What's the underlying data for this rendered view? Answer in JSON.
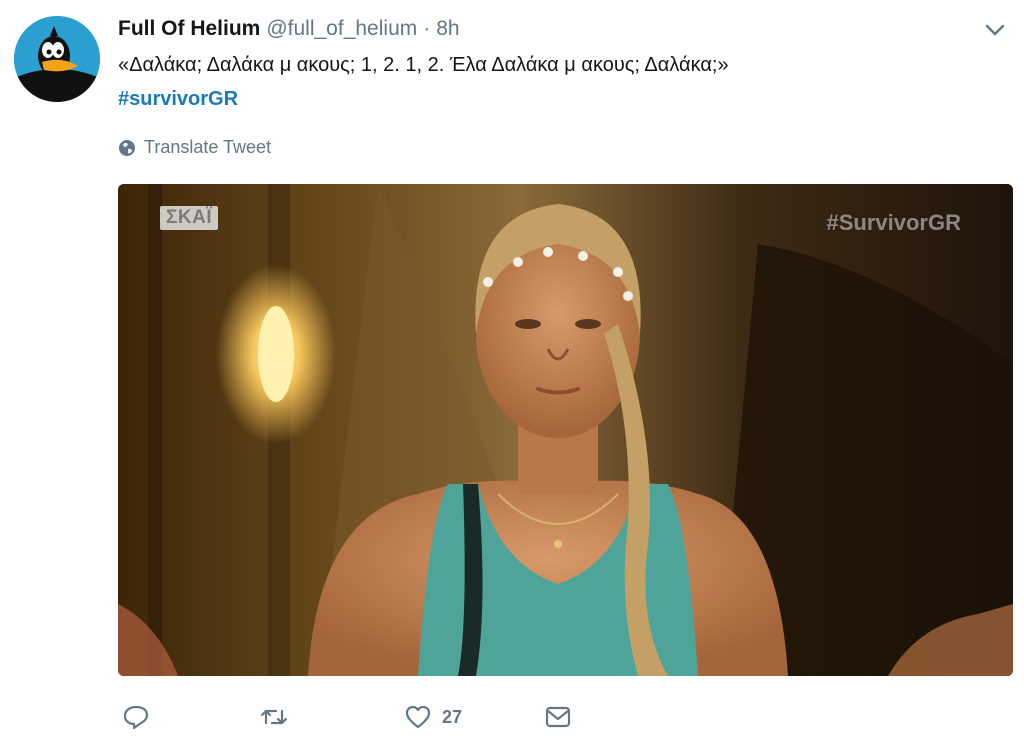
{
  "tweet": {
    "display_name": "Full Of Helium",
    "handle": "@full_of_helium",
    "separator": "·",
    "time": "8h",
    "text": "«Δαλάκα; Δαλάκα μ ακους; 1, 2. 1, 2. Έλα Δαλάκα μ ακους; Δαλάκα;»",
    "hashtag": "#survivorGR",
    "translate_label": "Translate Tweet",
    "avatar_icon": "daffy-duck-avatar",
    "caret_icon": "chevron-down-icon"
  },
  "media": {
    "watermark_left": "ΣΚΑΪ",
    "watermark_right": "#SurvivorGR"
  },
  "actions": {
    "reply_icon": "reply-icon",
    "retweet_icon": "retweet-icon",
    "like_icon": "heart-icon",
    "like_count": "27",
    "message_icon": "envelope-icon"
  },
  "colors": {
    "link": "#1b7ab8",
    "muted": "#657786",
    "text": "#14171a"
  }
}
